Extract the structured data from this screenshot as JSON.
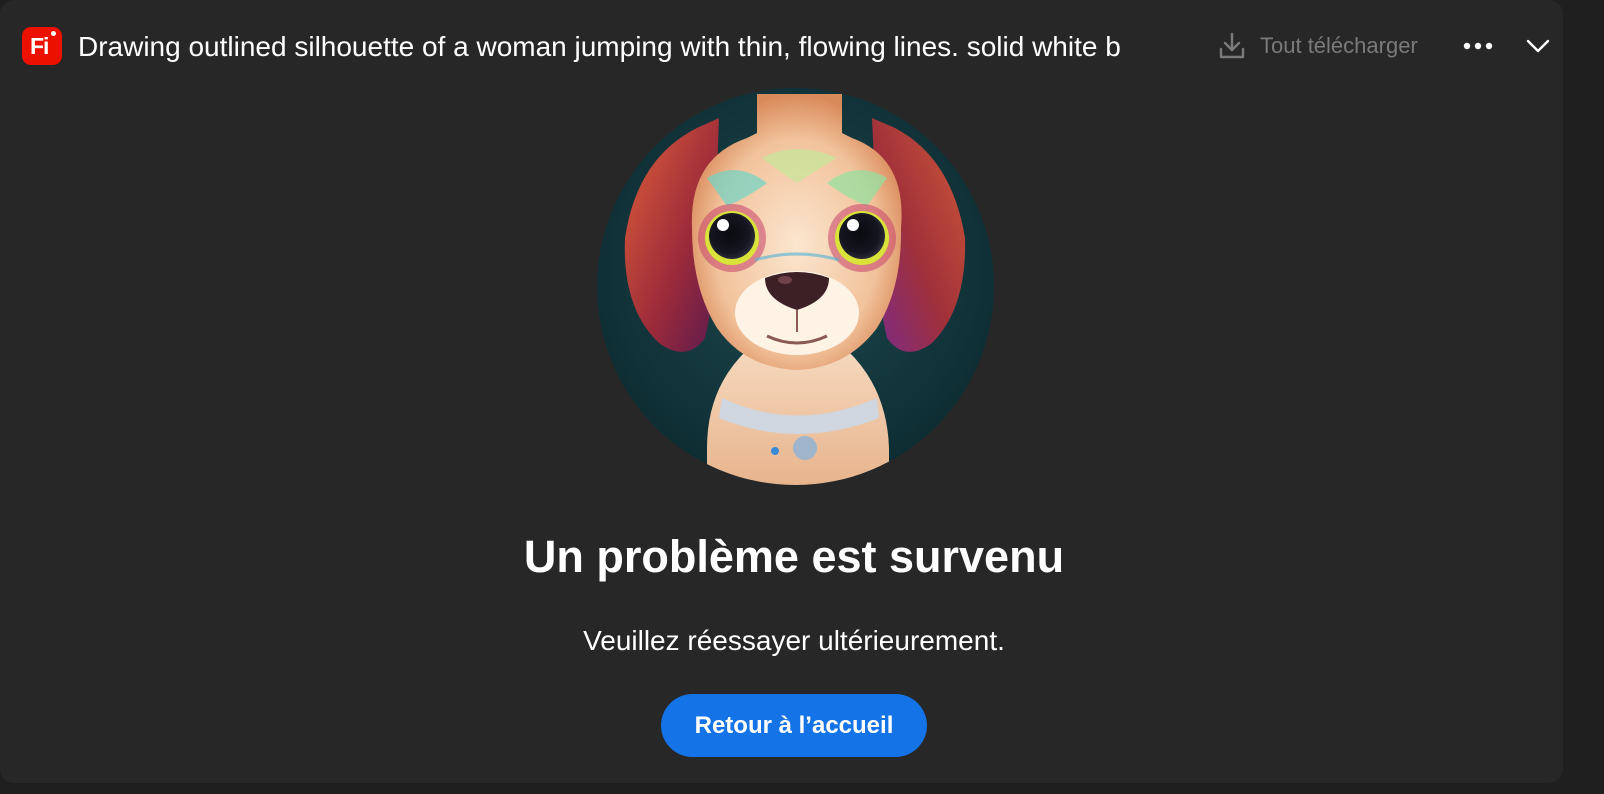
{
  "header": {
    "app_icon_label": "Fi",
    "title": "Drawing outlined silhouette of a woman jumping with thin, flowing lines. solid white b",
    "download_label": "Tout télécharger",
    "icons": {
      "app": "firefly-app-icon",
      "download": "download-icon",
      "more": "more-options-icon",
      "collapse": "chevron-down-icon"
    }
  },
  "error": {
    "title": "Un problème est survenu",
    "message": "Veuillez réessayer ultérieurement.",
    "button_label": "Retour à l’accueil"
  },
  "colors": {
    "panel_background": "#272727",
    "app_icon": "#eb1000",
    "primary_button": "#1473e6",
    "muted_text": "#7a7a7a"
  }
}
